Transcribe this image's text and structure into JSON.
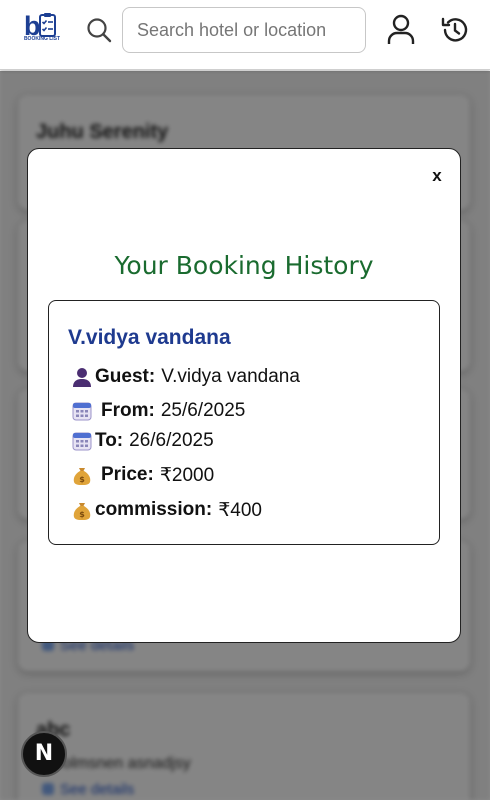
{
  "header": {
    "logo_caption": "BOOKING LIST",
    "search_placeholder": "Search hotel or location"
  },
  "background": {
    "card1_title": "Juhu Serenity",
    "card2_title": "abc",
    "card2_sub": "dhoolmsnen asnadjsy",
    "card_link": "See details"
  },
  "modal": {
    "close_label": "x",
    "title": "Your Booking History",
    "booking": {
      "name": "V.vidya vandana",
      "guest_label": "Guest:",
      "guest_value": "V.vidya vandana",
      "from_label": "From:",
      "from_value": "25/6/2025",
      "to_label": "To:",
      "to_value": "26/6/2025",
      "price_label": "Price:",
      "price_value": "₹2000",
      "commission_label": "commission:",
      "commission_value": "₹400"
    }
  },
  "badge": {
    "label": "N"
  },
  "icons": {
    "guest": "user-silhouette-icon",
    "from": "calendar-icon",
    "to": "calendar-icon",
    "price": "money-bag-icon",
    "commission": "money-bag-icon"
  },
  "colors": {
    "brand_blue": "#1d3f93",
    "title_green": "#1a6b2f",
    "name_blue": "#1e3a8f"
  }
}
